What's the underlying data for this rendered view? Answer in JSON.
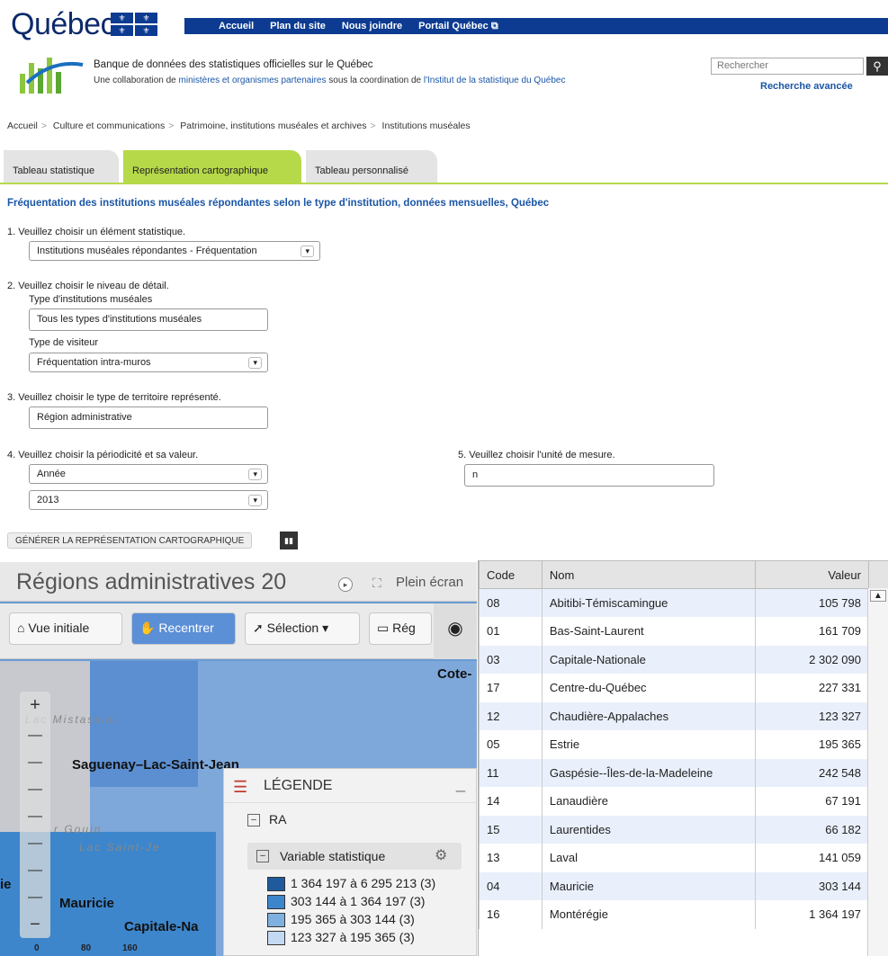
{
  "header": {
    "logo_text": "Québec",
    "nav": [
      "Accueil",
      "Plan du site",
      "Nous joindre",
      "Portail Québec ⧉"
    ],
    "title": "Banque de données des statistiques officielles sur le Québec",
    "sub_pre": "Une collaboration de ",
    "sub_link1": "ministères et organismes partenaires",
    "sub_mid": " sous la coordination de ",
    "sub_link2": "l'Institut de la statistique du Québec",
    "search_placeholder": "Rechercher",
    "advanced": "Recherche avancée"
  },
  "breadcrumb": [
    "Accueil",
    "Culture et communications",
    "Patrimoine, institutions muséales et archives",
    "Institutions muséales"
  ],
  "tabs": [
    "Tableau statistique",
    "Représentation cartographique",
    "Tableau personnalisé"
  ],
  "form": {
    "title": "Fréquentation des institutions muséales répondantes selon le type d'institution, données mensuelles, Québec",
    "q1": "1. Veuillez choisir un élément statistique.",
    "q1_value": "Institutions muséales répondantes - Fréquentation",
    "q2": "2. Veuillez choisir le niveau de détail.",
    "q2_label_a": "Type d'institutions muséales",
    "q2_value_a": "Tous les types d'institutions muséales",
    "q2_label_b": "Type de visiteur",
    "q2_value_b": "Fréquentation intra-muros",
    "q3": "3. Veuillez choisir le type de territoire représenté.",
    "q3_value": "Région administrative",
    "q4": "4. Veuillez choisir la périodicité et sa valeur.",
    "q4_value_a": "Année",
    "q4_value_b": "2013",
    "q5": "5. Veuillez choisir l'unité de mesure.",
    "q5_value": "n",
    "generate": "GÉNÉRER LA REPRÉSENTATION CARTOGRAPHIQUE"
  },
  "map": {
    "title": "Régions administratives 20",
    "fullscreen": "Plein écran",
    "toolbar": [
      "Vue initiale",
      "Recentrer",
      "Sélection ▾",
      "Rég"
    ],
    "places": [
      "Saguenay–Lac-Saint-Jean",
      "Mauricie",
      "Capitale-Na",
      "Cote-",
      "ie"
    ],
    "faint_places": [
      "Lac Mistassini",
      "r Gouin",
      "Lac Saint-Je"
    ],
    "scale": [
      "0",
      "80",
      "160"
    ],
    "legend_title": "LÉGENDE",
    "legend_ra": "RA",
    "legend_var": "Variable statistique",
    "legend_items": [
      {
        "label": "1 364 197 à 6 295 213 (3)",
        "color": "#1f5a9c"
      },
      {
        "label": "303 144 à 1 364 197 (3)",
        "color": "#3d86cc"
      },
      {
        "label": "195 365 à 303 144 (3)",
        "color": "#7eb1e0"
      },
      {
        "label": "123 327 à 195 365 (3)",
        "color": "#c3d9f1"
      }
    ]
  },
  "table": {
    "headers": [
      "Code",
      "Nom",
      "Valeur"
    ],
    "rows": [
      [
        "08",
        "Abitibi-Témiscamingue",
        "105 798"
      ],
      [
        "01",
        "Bas-Saint-Laurent",
        "161 709"
      ],
      [
        "03",
        "Capitale-Nationale",
        "2 302 090"
      ],
      [
        "17",
        "Centre-du-Québec",
        "227 331"
      ],
      [
        "12",
        "Chaudière-Appalaches",
        "123 327"
      ],
      [
        "05",
        "Estrie",
        "195 365"
      ],
      [
        "11",
        "Gaspésie--Îles-de-la-Madeleine",
        "242 548"
      ],
      [
        "14",
        "Lanaudière",
        "67 191"
      ],
      [
        "15",
        "Laurentides",
        "66 182"
      ],
      [
        "13",
        "Laval",
        "141 059"
      ],
      [
        "04",
        "Mauricie",
        "303 144"
      ],
      [
        "16",
        "Montérégie",
        "1 364 197"
      ]
    ]
  }
}
